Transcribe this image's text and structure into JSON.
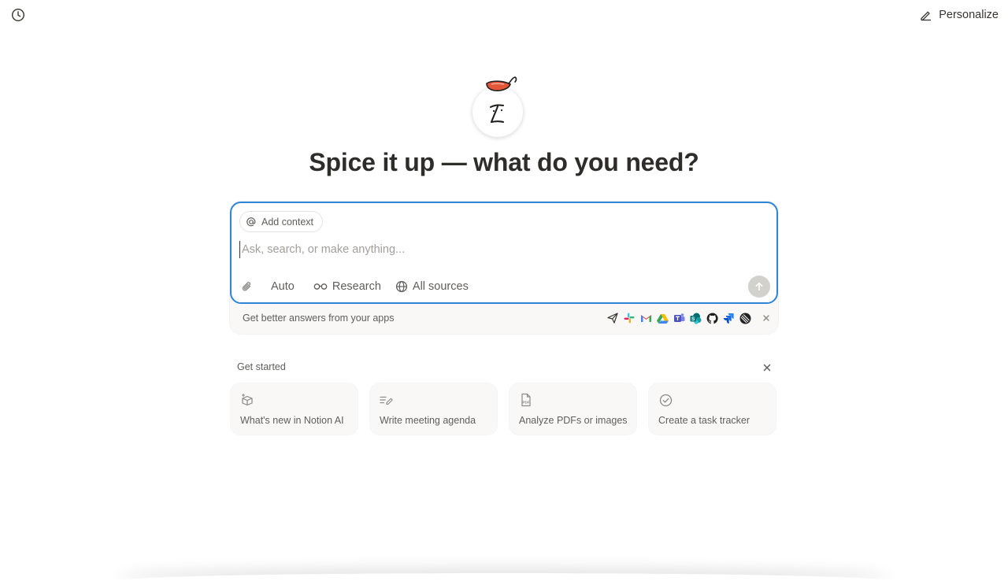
{
  "topbar": {
    "history_icon": "clock-history-icon",
    "personalize_label": "Personalize",
    "personalize_icon": "pencil-icon"
  },
  "hero": {
    "title": "Spice it up — what do you need?",
    "avatar_icon": "notion-ai-face-with-chili-hat"
  },
  "composer": {
    "add_context_label": "Add context",
    "input_placeholder": "Ask, search, or make anything...",
    "input_value": "",
    "toolbar": {
      "attach_icon": "paperclip-icon",
      "auto_label": "Auto",
      "research_label": "Research",
      "sources_label": "All sources"
    },
    "accent_color": "#2f84d8",
    "send_icon": "arrow-up-icon"
  },
  "apps_banner": {
    "text": "Get better answers from your apps",
    "apps": [
      "send",
      "slack",
      "gmail",
      "google-drive",
      "teams",
      "sharepoint",
      "github",
      "jira",
      "linear"
    ]
  },
  "get_started": {
    "title": "Get started",
    "cards": [
      {
        "label": "What's new in Notion AI",
        "icon": "sparkle-box-icon"
      },
      {
        "label": "Write meeting agenda",
        "icon": "lines-pen-icon"
      },
      {
        "label": "Analyze PDFs or images",
        "icon": "pdf-file-icon"
      },
      {
        "label": "Create a task tracker",
        "icon": "check-circle-icon"
      }
    ]
  }
}
